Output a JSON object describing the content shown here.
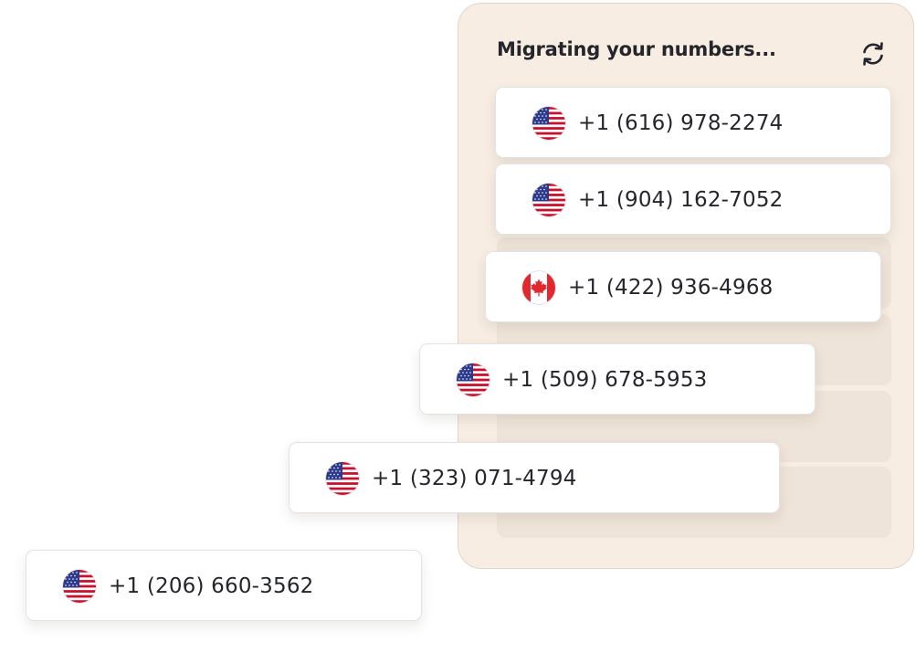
{
  "panel": {
    "title": "Migrating your numbers...",
    "refresh_icon": "refresh-icon"
  },
  "numbers": [
    {
      "number": "+1 (616) 978-2274",
      "flag": "us-flag-icon",
      "country": "US"
    },
    {
      "number": "+1 (904) 162-7052",
      "flag": "us-flag-icon",
      "country": "US"
    },
    {
      "number": "+1 (422) 936-4968",
      "flag": "canada-flag-icon",
      "country": "CA"
    },
    {
      "number": "+1 (509) 678-5953",
      "flag": "us-flag-icon",
      "country": "US"
    },
    {
      "number": "+1 (323) 071-4794",
      "flag": "us-flag-icon",
      "country": "US"
    },
    {
      "number": "+1 (206) 660-3562",
      "flag": "us-flag-icon",
      "country": "US"
    }
  ],
  "colors": {
    "panel_bg": "#f7ede3",
    "slot_bg": "#efe4d9",
    "text": "#25262b",
    "us_red": "#c8102e",
    "us_blue": "#2b3a8c",
    "ca_red": "#e0282e"
  }
}
